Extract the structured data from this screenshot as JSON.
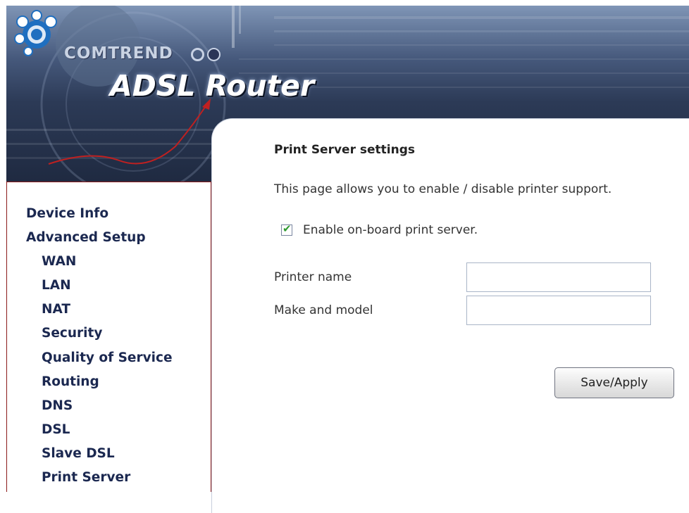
{
  "header": {
    "brand": "COMTREND",
    "product_title": "ADSL Router"
  },
  "sidebar": {
    "items": [
      {
        "label": "Device Info",
        "level": 0
      },
      {
        "label": "Advanced Setup",
        "level": 0
      },
      {
        "label": "WAN",
        "level": 1
      },
      {
        "label": "LAN",
        "level": 1
      },
      {
        "label": "NAT",
        "level": 1
      },
      {
        "label": "Security",
        "level": 1
      },
      {
        "label": "Quality of Service",
        "level": 1
      },
      {
        "label": "Routing",
        "level": 1
      },
      {
        "label": "DNS",
        "level": 1
      },
      {
        "label": "DSL",
        "level": 1
      },
      {
        "label": "Slave DSL",
        "level": 1
      },
      {
        "label": "Print Server",
        "level": 1
      }
    ]
  },
  "main": {
    "heading": "Print Server settings",
    "description": "This page allows you to enable / disable printer support.",
    "enable_checkbox": {
      "label": "Enable on-board print server.",
      "checked": true
    },
    "fields": [
      {
        "label": "Printer name",
        "value": ""
      },
      {
        "label": "Make and model",
        "value": ""
      }
    ],
    "save_button": "Save/Apply"
  },
  "colors": {
    "nav_text": "#1b2850",
    "sidebar_border": "#8b1a1a",
    "banner_dark": "#1f2a41",
    "check_green": "#2f9a2f"
  }
}
